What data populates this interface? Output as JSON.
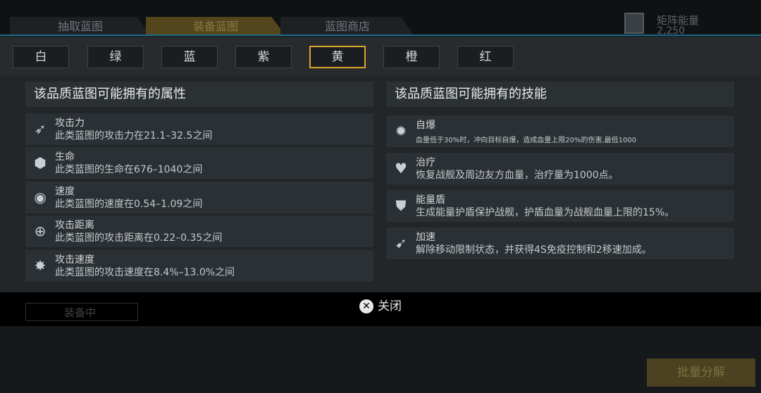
{
  "top_tabs": [
    "抽取蓝图",
    "装备蓝图",
    "蓝图商店"
  ],
  "energy": {
    "label": "矩阵能量",
    "value": "2,250"
  },
  "quality_tabs": [
    "白",
    "绿",
    "蓝",
    "紫",
    "黄",
    "橙",
    "红"
  ],
  "selected_quality": "黄",
  "attributes": {
    "heading": "该品质蓝图可能拥有的属性",
    "items": [
      {
        "icon": "attack-icon",
        "title": "攻击力",
        "desc": "此类蓝图的攻击力在21.1–32.5之间"
      },
      {
        "icon": "health-icon",
        "title": "生命",
        "desc": "此类蓝图的生命在676–1040之间"
      },
      {
        "icon": "speed-icon",
        "title": "速度",
        "desc": "此类蓝图的速度在0.54–1.09之间"
      },
      {
        "icon": "range-icon",
        "title": "攻击距离",
        "desc": "此类蓝图的攻击距离在0.22–0.35之间"
      },
      {
        "icon": "attack-speed-icon",
        "title": "攻击速度",
        "desc": "此类蓝图的攻击速度在8.4%–13.0%之间"
      }
    ]
  },
  "skills": {
    "heading": "该品质蓝图可能拥有的技能",
    "items": [
      {
        "icon": "explode-icon",
        "title": "自爆",
        "desc": "血量低于30%时，冲向目标自爆，造成血量上限20%的伤害,最低1000"
      },
      {
        "icon": "heal-icon",
        "title": "治疗",
        "desc": "恢复战舰及周边友方血量，治疗量为1000点。"
      },
      {
        "icon": "shield-icon",
        "title": "能量盾",
        "desc": "生成能量护盾保护战舰，护盾血量为战舰血量上限的15%。"
      },
      {
        "icon": "boost-icon",
        "title": "加速",
        "desc": "解除移动限制状态，并获得4S免疫控制和2移速加成。"
      }
    ]
  },
  "close_label": "关闭",
  "background_button": "装备中",
  "batch_label": "批量分解",
  "colors": {
    "accent": "#d9a52a",
    "topline": "#1c6a8a"
  }
}
